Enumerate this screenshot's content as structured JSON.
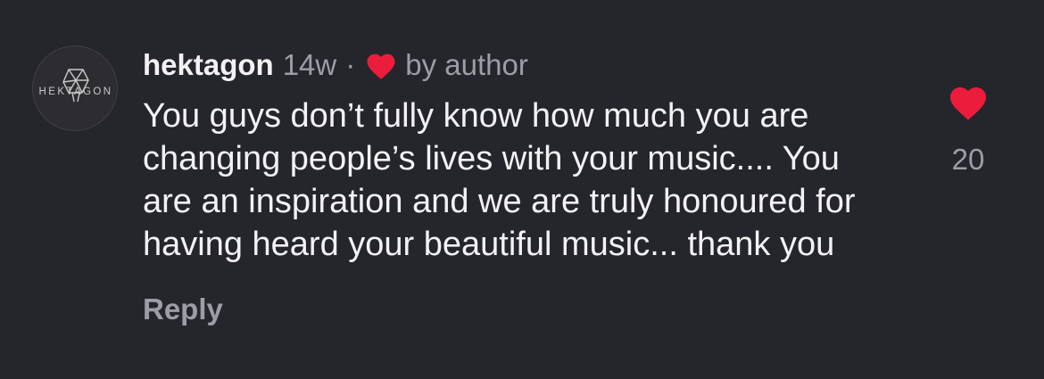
{
  "comment": {
    "avatar_logo_text": "HEKTAGON",
    "username": "hektagon",
    "time_ago": "14w",
    "separator": "·",
    "liked_by_label": "by author",
    "text": "You guys don’t fully know how much you are changing people’s lives with your music.... You are an inspiration and we are truly honoured for having heard your beautiful music... thank you",
    "reply_label": "Reply",
    "like_count": "20",
    "liked": true
  },
  "colors": {
    "background": "#25262b",
    "primary_text": "#f2f2f4",
    "secondary_text": "#9c9ea5",
    "heart_red": "#ec1c3c"
  },
  "icons": {
    "author_liked": "heart-icon",
    "like_button": "heart-filled-icon"
  }
}
